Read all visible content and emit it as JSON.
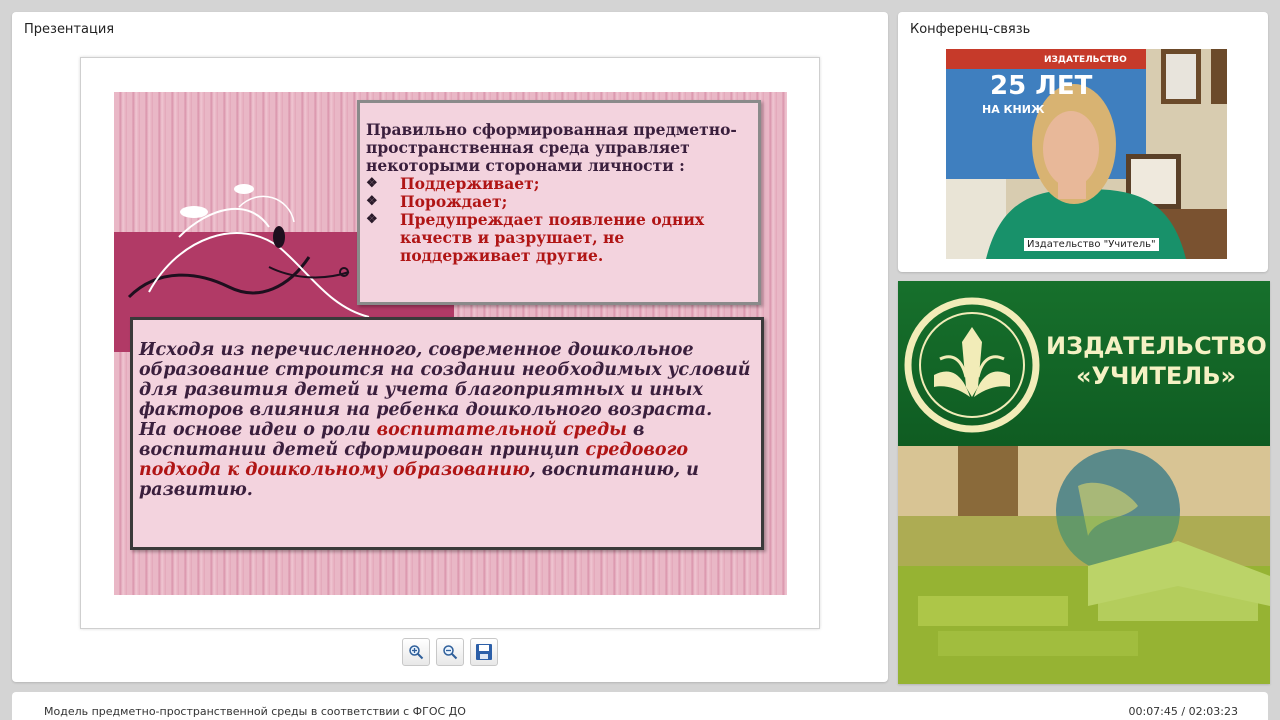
{
  "presentation": {
    "title": "Презентация",
    "slide": {
      "box1": {
        "intro": "Правильно сформированная предметно-пространственная среда управляет некоторыми сторонами личности :",
        "bullets": [
          "Поддерживает;",
          "Порождает;",
          "Предупреждает появление одних качеств и разрушает, не поддерживает другие."
        ]
      },
      "box2": {
        "p1": "Исходя из перечисленного,  современное дошкольное образование строится на создании необходимых условий для развития детей и учета благоприятных  и  иных факторов влияния на  ребенка дошкольного возраста.",
        "p2_a": "На основе идеи о роли ",
        "p2_b": "воспитательной среды",
        "p2_c": " в воспитании детей сформирован принцип ",
        "p2_d": "средового подхода  к дошкольному образованию",
        "p2_e": ", воспитанию, и развитию."
      }
    },
    "controls": {
      "zoom_in_icon": "zoom-in-icon",
      "zoom_out_icon": "zoom-out-icon",
      "save_icon": "save-icon"
    }
  },
  "conference": {
    "title": "Конференц-связь",
    "video_label": "Издательство \"Учитель\"",
    "banner_text_1": "25 ЛЕТ",
    "banner_text_2": "НА КНИЖ",
    "banner_text_3": "ИЗДАТЕЛЬСТВО"
  },
  "logo": {
    "line1": "ИЗДАТЕЛЬСТВО",
    "line2": "«УЧИТЕЛЬ»"
  },
  "bottom": {
    "title": "Модель предметно-пространственной среды в соответствии с ФГОС ДО",
    "time": "00:07:45 / 02:03:23"
  },
  "colors": {
    "accent_red": "#b01515",
    "logo_green": "#17702c",
    "slide_pink": "#f3d3de"
  }
}
